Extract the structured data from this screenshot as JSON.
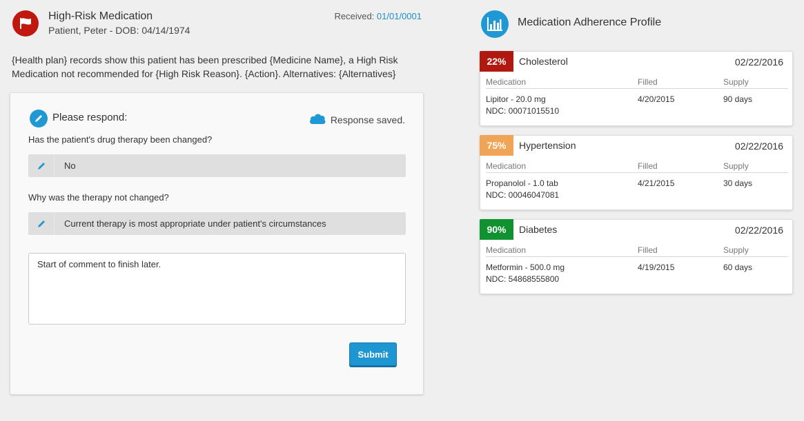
{
  "alert": {
    "title": "High-Risk Medication",
    "patient_line": "Patient, Peter -  DOB: 04/14/1974",
    "received_label": "Received:",
    "received_date": "01/01/0001",
    "message": "{Health plan} records show this patient has been prescribed {Medicine Name}, a High Risk Medication not recommended for {High Risk Reason}. {Action}. Alternatives: {Alternatives}"
  },
  "response": {
    "header": "Please respond:",
    "saved_status": "Response saved.",
    "q1": "Has the patient's drug therapy been changed?",
    "a1": "No",
    "q2": "Why was the therapy not changed?",
    "a2": "Current therapy is most appropriate under patient's circumstances",
    "comment": "Start of comment to finish later.",
    "submit_label": "Submit"
  },
  "adherence": {
    "title": "Medication Adherence Profile",
    "col_medication": "Medication",
    "col_filled": "Filled",
    "col_supply": "Supply",
    "profiles": [
      {
        "percent": "22%",
        "condition": "Cholesterol",
        "date": "02/22/2016",
        "medication": "Lipitor - 20.0 mg",
        "ndc": "NDC: 00071015510",
        "filled": "4/20/2015",
        "supply": "90 days",
        "color": "#b01910"
      },
      {
        "percent": "75%",
        "condition": "Hypertension",
        "date": "02/22/2016",
        "medication": "Propanolol - 1.0 tab",
        "ndc": "NDC: 00046047081",
        "filled": "4/21/2015",
        "supply": "30 days",
        "color": "#f0a556"
      },
      {
        "percent": "90%",
        "condition": "Diabetes",
        "date": "02/22/2016",
        "medication": "Metformin - 500.0 mg",
        "ndc": "NDC: 54868555800",
        "filled": "4/19/2015",
        "supply": "60 days",
        "color": "#109230"
      }
    ]
  }
}
